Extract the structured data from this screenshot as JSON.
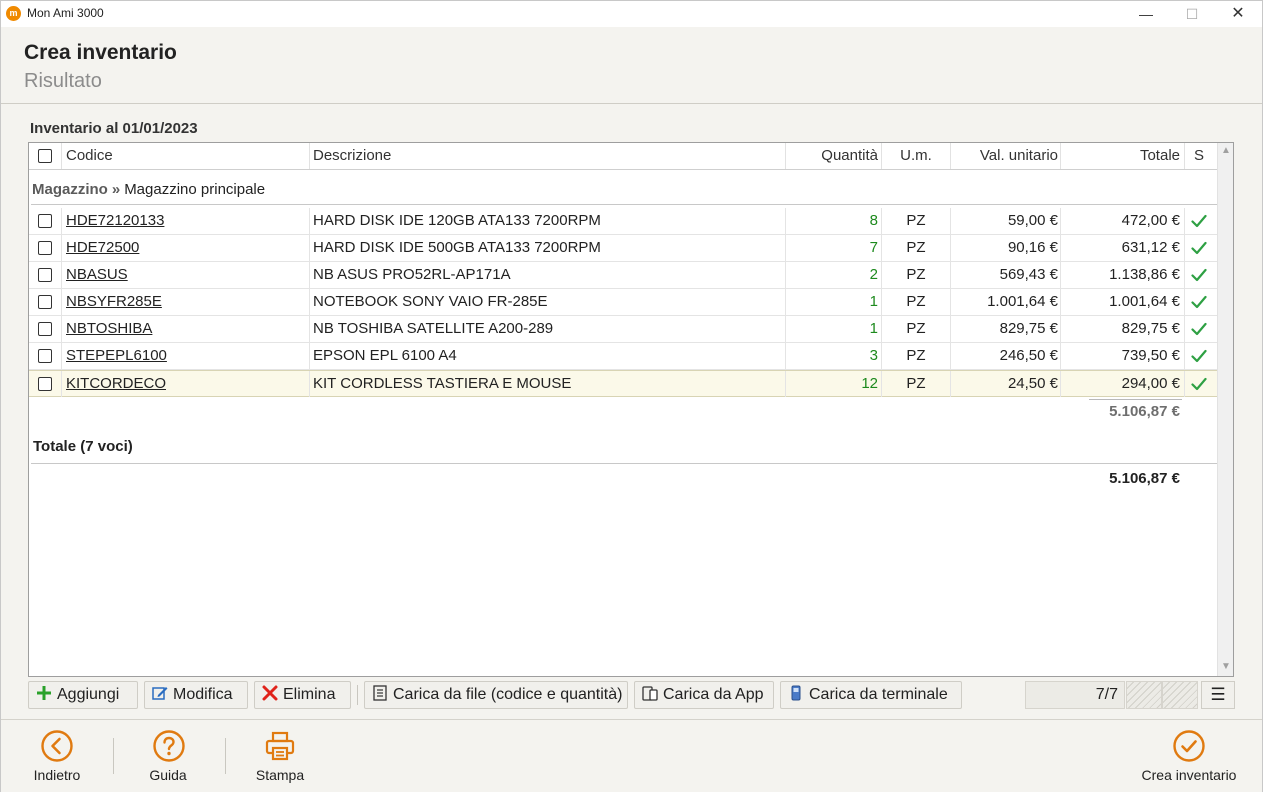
{
  "window": {
    "title": "Mon Ami 3000",
    "icon_text": "m",
    "min": "—",
    "max": "☐",
    "close": "✕"
  },
  "header": {
    "title": "Crea inventario",
    "subtitle": "Risultato"
  },
  "section": {
    "title": "Inventario al 01/01/2023"
  },
  "table": {
    "columns": {
      "code": "Codice",
      "desc": "Descrizione",
      "qty": "Quantità",
      "um": "U.m.",
      "val": "Val. unitario",
      "tot": "Totale",
      "s": "S"
    },
    "group": {
      "level1": "Magazzino",
      "separator": "»",
      "level2": "Magazzino principale"
    },
    "rows": [
      {
        "code": "HDE72120133",
        "desc": "HARD DISK IDE 120GB ATA133 7200RPM",
        "qty": "8",
        "um": "PZ",
        "val": "59,00 €",
        "tot": "472,00 €"
      },
      {
        "code": "HDE72500",
        "desc": "HARD DISK IDE 500GB ATA133 7200RPM",
        "qty": "7",
        "um": "PZ",
        "val": "90,16 €",
        "tot": "631,12 €"
      },
      {
        "code": "NBASUS",
        "desc": "NB ASUS PRO52RL-AP171A",
        "qty": "2",
        "um": "PZ",
        "val": "569,43 €",
        "tot": "1.138,86 €"
      },
      {
        "code": "NBSYFR285E",
        "desc": "NOTEBOOK SONY VAIO FR-285E",
        "qty": "1",
        "um": "PZ",
        "val": "1.001,64 €",
        "tot": "1.001,64 €"
      },
      {
        "code": "NBTOSHIBA",
        "desc": "NB TOSHIBA SATELLITE A200-289",
        "qty": "1",
        "um": "PZ",
        "val": "829,75 €",
        "tot": "829,75 €"
      },
      {
        "code": "STEPEPL6100",
        "desc": "EPSON EPL 6100 A4",
        "qty": "3",
        "um": "PZ",
        "val": "246,50 €",
        "tot": "739,50 €"
      },
      {
        "code": "KITCORDECO",
        "desc": "KIT CORDLESS TASTIERA E MOUSE",
        "qty": "12",
        "um": "PZ",
        "val": "24,50 €",
        "tot": "294,00 €"
      }
    ],
    "subtotal": "5.106,87 €",
    "total_label": "Totale (7 voci)",
    "grand_total": "5.106,87 €",
    "scroll_up": "▲",
    "scroll_down": "▼"
  },
  "toolbar": {
    "add": "Aggiungi",
    "edit": "Modifica",
    "delete": "Elimina",
    "load_file": "Carica da file (codice e quantità)",
    "load_app": "Carica da App",
    "load_terminal": "Carica da terminale",
    "pager": "7/7",
    "menu": "☰"
  },
  "footer": {
    "back": "Indietro",
    "help": "Guida",
    "print": "Stampa",
    "create": "Crea inventario"
  },
  "colors": {
    "accent": "#e07a10",
    "qty_green": "#1d8a1d",
    "check_green": "#2ea043",
    "delete_red": "#e0231a",
    "add_green": "#2aa12a",
    "edit_blue": "#2a6cc0"
  }
}
